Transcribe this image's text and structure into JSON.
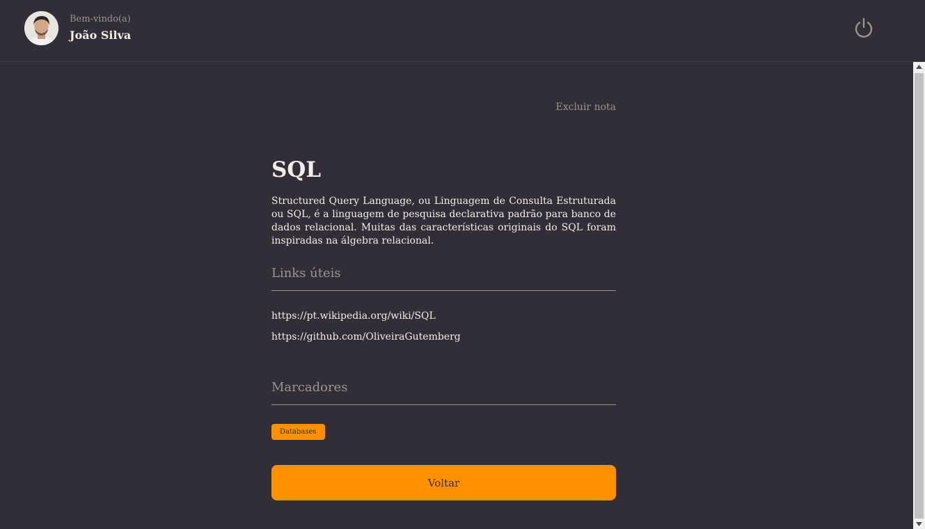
{
  "header": {
    "welcome_label": "Bem-vindo(a)",
    "user_name": "João Silva",
    "avatar_icon": "user-avatar",
    "power_icon": "power-icon"
  },
  "note": {
    "delete_label": "Excluir nota",
    "title": "SQL",
    "body": "Structured Query Language, ou Linguagem de Consulta Estruturada ou SQL, é a linguagem de pesquisa declarativa padrão para banco de dados relacional. Muitas das características originais do SQL foram inspiradas na álgebra relacional.",
    "links_title": "Links úteis",
    "links": [
      "https://pt.wikipedia.org/wiki/SQL",
      "https://github.com/OliveiraGutemberg"
    ],
    "tags_title": "Marcadores",
    "tags": [
      "Databases"
    ],
    "back_label": "Voltar"
  },
  "colors": {
    "background": "#312e38",
    "accent": "#ff9000",
    "muted_text": "#999591",
    "text": "#f4ede8"
  }
}
